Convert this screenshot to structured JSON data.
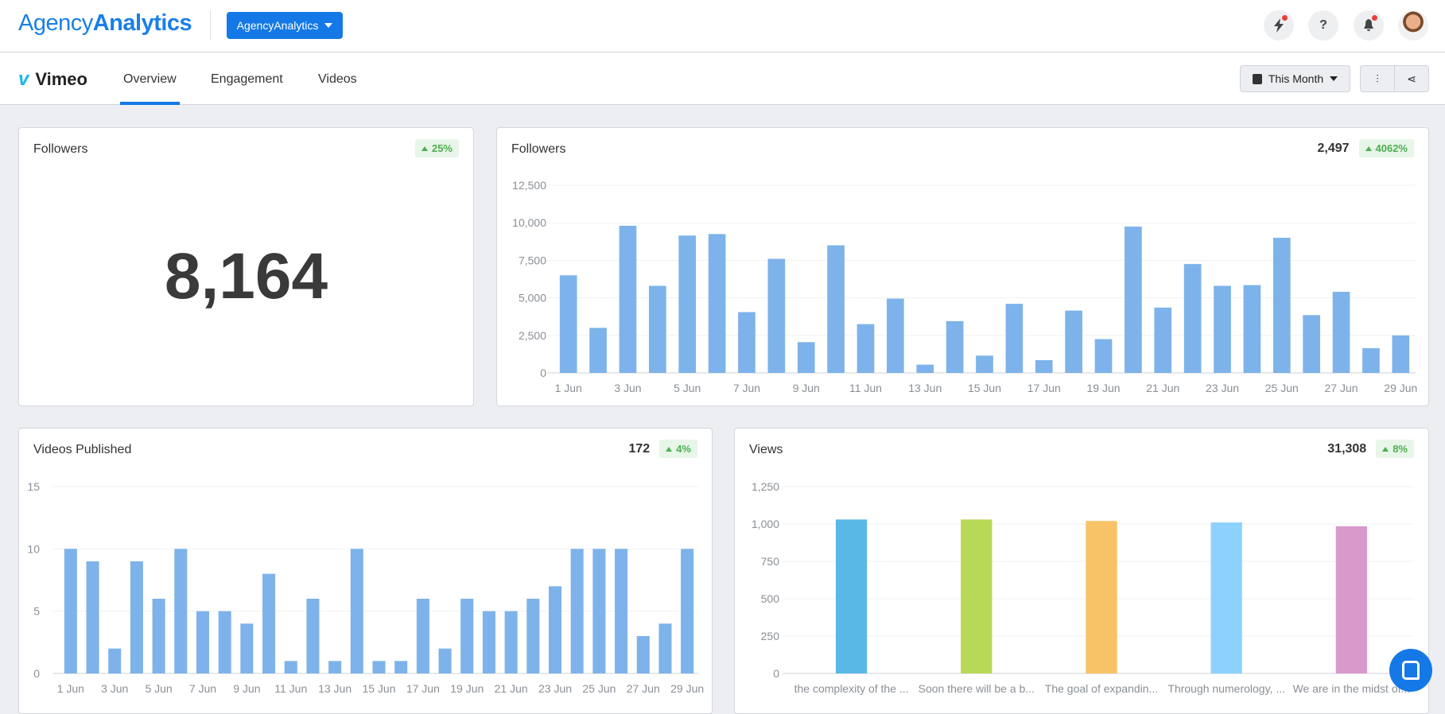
{
  "header": {
    "logo_light": "Agency",
    "logo_bold": "Analytics",
    "account_button": "AgencyAnalytics",
    "icons": [
      "lightning-icon",
      "help-icon",
      "bell-icon"
    ],
    "help_glyph": "?"
  },
  "subnav": {
    "app": "Vimeo",
    "tabs": [
      "Overview",
      "Engagement",
      "Videos"
    ],
    "active_tab": "Overview",
    "date_range": "This Month"
  },
  "colors": {
    "accent": "#1479e6",
    "bar": "#7db3ea",
    "positive": "#4caf50"
  },
  "cards": {
    "followers_total": {
      "title": "Followers",
      "value": "8,164",
      "change": "25%"
    },
    "followers_chart": {
      "title": "Followers",
      "total": "2,497",
      "change": "4062%"
    },
    "videos_published": {
      "title": "Videos Published",
      "total": "172",
      "change": "4%"
    },
    "views": {
      "title": "Views",
      "total": "31,308",
      "change": "8%"
    }
  },
  "chart_data": [
    {
      "id": "followers",
      "type": "bar",
      "ylim": [
        0,
        12500
      ],
      "y_ticks": [
        "0",
        "2,500",
        "5,000",
        "7,500",
        "10,000",
        "12,500"
      ],
      "categories": [
        "1 Jun",
        "2 Jun",
        "3 Jun",
        "4 Jun",
        "5 Jun",
        "6 Jun",
        "7 Jun",
        "8 Jun",
        "9 Jun",
        "10 Jun",
        "11 Jun",
        "12 Jun",
        "13 Jun",
        "14 Jun",
        "15 Jun",
        "16 Jun",
        "17 Jun",
        "18 Jun",
        "19 Jun",
        "20 Jun",
        "21 Jun",
        "22 Jun",
        "23 Jun",
        "24 Jun",
        "25 Jun",
        "26 Jun",
        "27 Jun",
        "28 Jun",
        "29 Jun"
      ],
      "x_tick_labels": [
        "1 Jun",
        "3 Jun",
        "5 Jun",
        "7 Jun",
        "9 Jun",
        "11 Jun",
        "13 Jun",
        "15 Jun",
        "17 Jun",
        "19 Jun",
        "21 Jun",
        "23 Jun",
        "25 Jun",
        "27 Jun",
        "29 Jun"
      ],
      "values": [
        6500,
        3000,
        9800,
        5800,
        9150,
        9250,
        4050,
        7600,
        2050,
        8500,
        3250,
        4950,
        550,
        3450,
        1150,
        4600,
        850,
        4150,
        2250,
        9750,
        4350,
        7250,
        5800,
        5850,
        9000,
        3850,
        5400,
        1650,
        2500
      ],
      "grid": true
    },
    {
      "id": "videos",
      "type": "bar",
      "ylim": [
        0,
        15
      ],
      "y_ticks": [
        "0",
        "5",
        "10",
        "15"
      ],
      "categories": [
        "1 Jun",
        "2 Jun",
        "3 Jun",
        "4 Jun",
        "5 Jun",
        "6 Jun",
        "7 Jun",
        "8 Jun",
        "9 Jun",
        "10 Jun",
        "11 Jun",
        "12 Jun",
        "13 Jun",
        "14 Jun",
        "15 Jun",
        "16 Jun",
        "17 Jun",
        "18 Jun",
        "19 Jun",
        "20 Jun",
        "21 Jun",
        "22 Jun",
        "23 Jun",
        "24 Jun",
        "25 Jun",
        "26 Jun",
        "27 Jun",
        "28 Jun",
        "29 Jun"
      ],
      "x_tick_labels": [
        "1 Jun",
        "3 Jun",
        "5 Jun",
        "7 Jun",
        "9 Jun",
        "11 Jun",
        "13 Jun",
        "15 Jun",
        "17 Jun",
        "19 Jun",
        "21 Jun",
        "23 Jun",
        "25 Jun",
        "27 Jun",
        "29 Jun"
      ],
      "values": [
        10,
        9,
        2,
        9,
        6,
        10,
        5,
        5,
        4,
        8,
        1,
        6,
        1,
        10,
        1,
        1,
        6,
        2,
        6,
        5,
        5,
        6,
        7,
        10,
        10,
        10,
        3,
        4,
        10
      ],
      "grid": true
    },
    {
      "id": "views",
      "type": "bar",
      "ylim": [
        0,
        1250
      ],
      "y_ticks": [
        "0",
        "250",
        "500",
        "750",
        "1,000",
        "1,250"
      ],
      "categories": [
        "the complexity of the ...",
        "Soon there will be a b...",
        "The goal of expandin...",
        "Through numerology, ...",
        "We are in the midst of..."
      ],
      "x_tick_labels": [
        "the complexity of the ...",
        "Soon there will be a b...",
        "The goal of expandin...",
        "Through numerology, ...",
        "We are in the midst of..."
      ],
      "values": [
        1030,
        1030,
        1020,
        1010,
        985
      ],
      "colors": [
        "#5ab8e6",
        "#b8d957",
        "#f8c266",
        "#8dd1ff",
        "#d89acb"
      ],
      "grid": true
    }
  ]
}
